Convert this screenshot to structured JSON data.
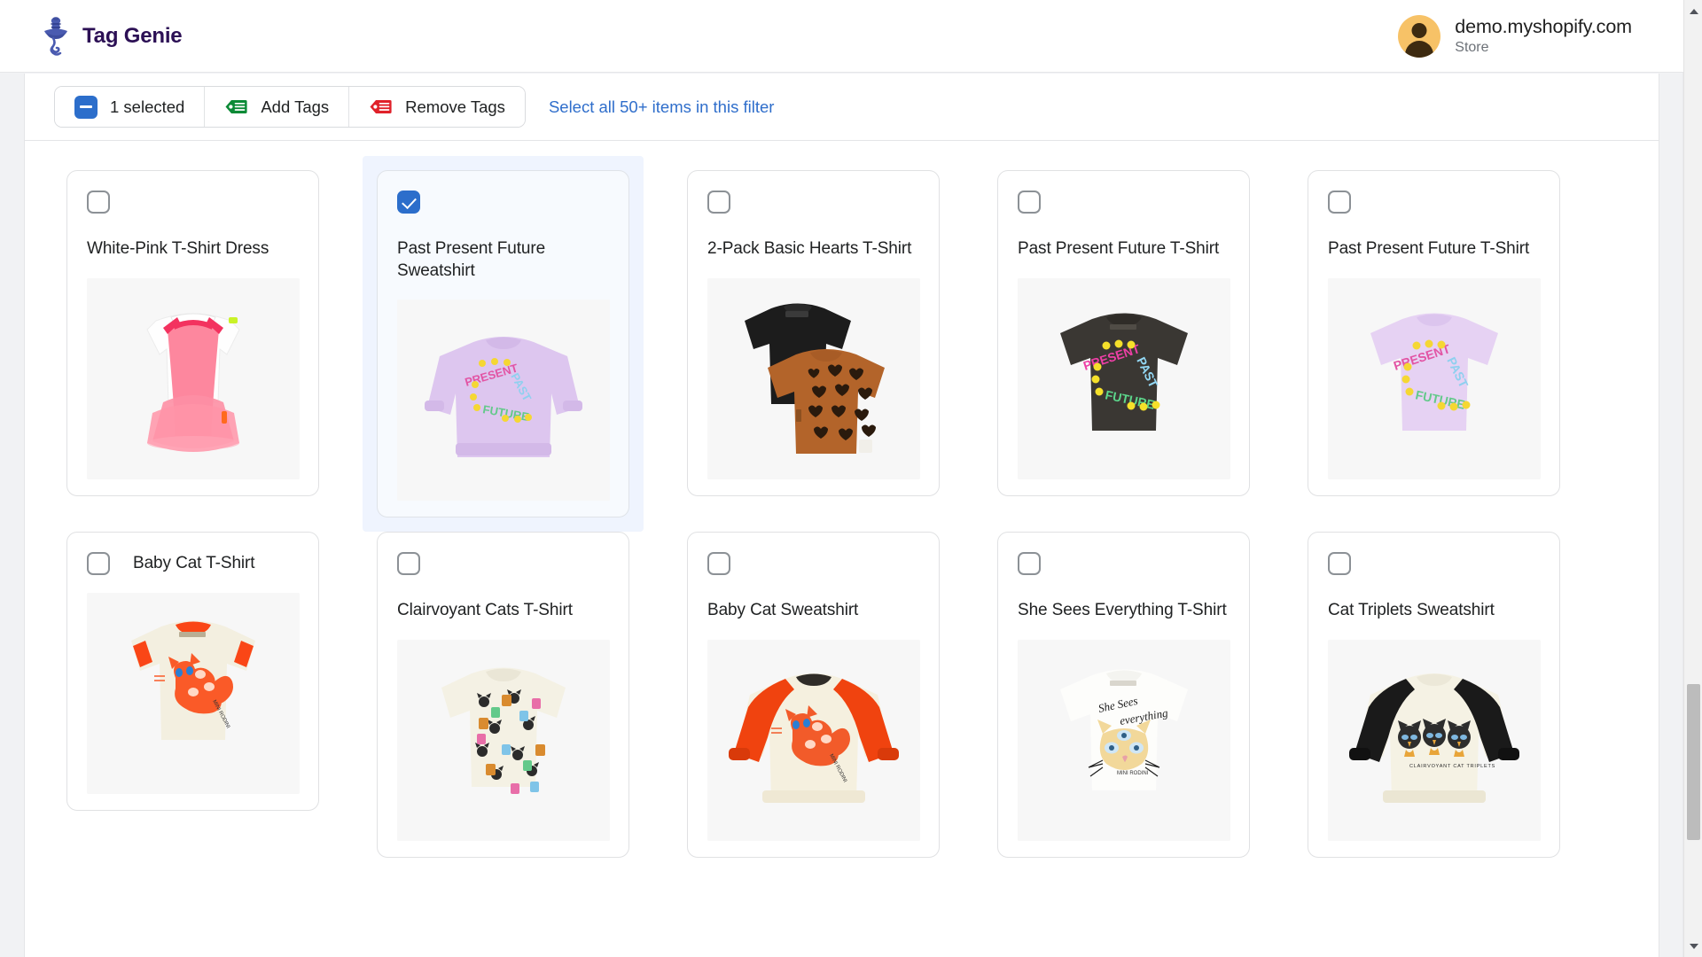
{
  "app": {
    "brand_name": "Tag Genie",
    "logo_icon": "genie-lamp-icon"
  },
  "store": {
    "domain": "demo.myshopify.com",
    "subtitle": "Store",
    "avatar_icon": "user-avatar-icon"
  },
  "bulkbar": {
    "selected_label": "1 selected",
    "select_checkbox_icon": "indeterminate-checkbox-icon",
    "add_tags_label": "Add Tags",
    "add_tags_icon": "tag-add-icon",
    "remove_tags_label": "Remove Tags",
    "remove_tags_icon": "tag-remove-icon",
    "select_all_label": "Select all 50+ items in this filter"
  },
  "colors": {
    "accent_blue": "#2c6ecb",
    "link_blue": "#2f6ecb",
    "add_tag_green": "#0b8a36",
    "remove_tag_red": "#e0212a",
    "brand_purple": "#2c1055",
    "selected_card_bg": "#f7fafe",
    "selection_halo": "#eff4fe"
  },
  "products": [
    {
      "title": "White-Pink T-Shirt Dress",
      "selected": false,
      "title_inline": false,
      "image": "pink-tulle-dress"
    },
    {
      "title": "Past Present Future Sweatshirt",
      "selected": true,
      "title_inline": false,
      "image": "lilac-sweatshirt-stars"
    },
    {
      "title": "2-Pack Basic Hearts T-Shirt",
      "selected": false,
      "title_inline": false,
      "image": "black-and-brown-hearts-tees"
    },
    {
      "title": "Past Present Future T-Shirt",
      "selected": false,
      "title_inline": false,
      "image": "dark-tee-stars"
    },
    {
      "title": "Past Present Future T-Shirt",
      "selected": false,
      "title_inline": false,
      "image": "lilac-tee-stars"
    },
    {
      "title": "Baby Cat T-Shirt",
      "selected": false,
      "title_inline": true,
      "image": "cream-tee-orange-cat"
    },
    {
      "title": "Clairvoyant Cats T-Shirt",
      "selected": false,
      "title_inline": false,
      "image": "cream-tee-cats-pattern"
    },
    {
      "title": "Baby Cat Sweatshirt",
      "selected": false,
      "title_inline": false,
      "image": "orange-sleeve-cat-sweatshirt"
    },
    {
      "title": "She Sees Everything T-Shirt",
      "selected": false,
      "title_inline": false,
      "image": "white-tee-cat-face"
    },
    {
      "title": "Cat Triplets Sweatshirt",
      "selected": false,
      "title_inline": false,
      "image": "black-sleeve-cat-triplets"
    }
  ]
}
